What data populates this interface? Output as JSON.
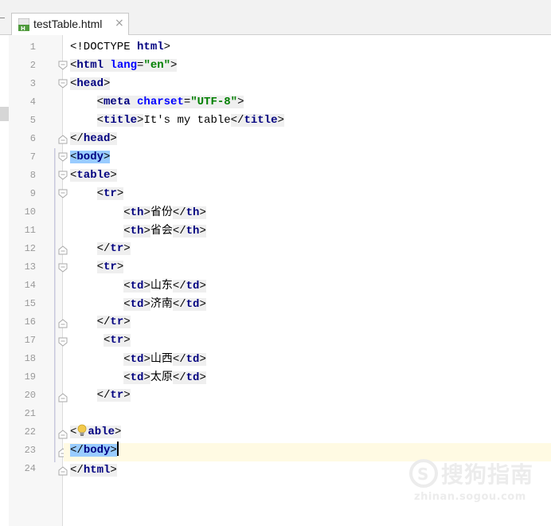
{
  "tab": {
    "title": "testTable.html",
    "close": "×"
  },
  "line_numbers": [
    "1",
    "2",
    "3",
    "4",
    "5",
    "6",
    "7",
    "8",
    "9",
    "10",
    "11",
    "12",
    "13",
    "14",
    "15",
    "16",
    "17",
    "18",
    "19",
    "20",
    "21",
    "22",
    "23",
    "24"
  ],
  "code": {
    "doctype_open": "<!DOCTYPE ",
    "doctype_kw": "html",
    "doctype_close": ">",
    "html": "html",
    "lang_attr": "lang",
    "lang_val": "\"en\"",
    "head": "head",
    "meta": "meta",
    "charset_attr": "charset",
    "charset_val": "\"UTF-8\"",
    "title": "title",
    "title_text": "It's my table",
    "body": "body",
    "table": "table",
    "table_tail": "able",
    "tr": "tr",
    "th": "th",
    "td": "td",
    "th1": "省份",
    "th2": "省会",
    "td1": "山东",
    "td2": "济南",
    "td3": "山西",
    "td4": "太原"
  },
  "watermark": {
    "brand": "搜狗指南",
    "url": "zhinan.sogou.com"
  },
  "colors": {
    "tag": "#000080",
    "attr": "#0000ff",
    "string": "#008000",
    "highlight": "#99ccff",
    "caret_row": "#fffae3"
  }
}
